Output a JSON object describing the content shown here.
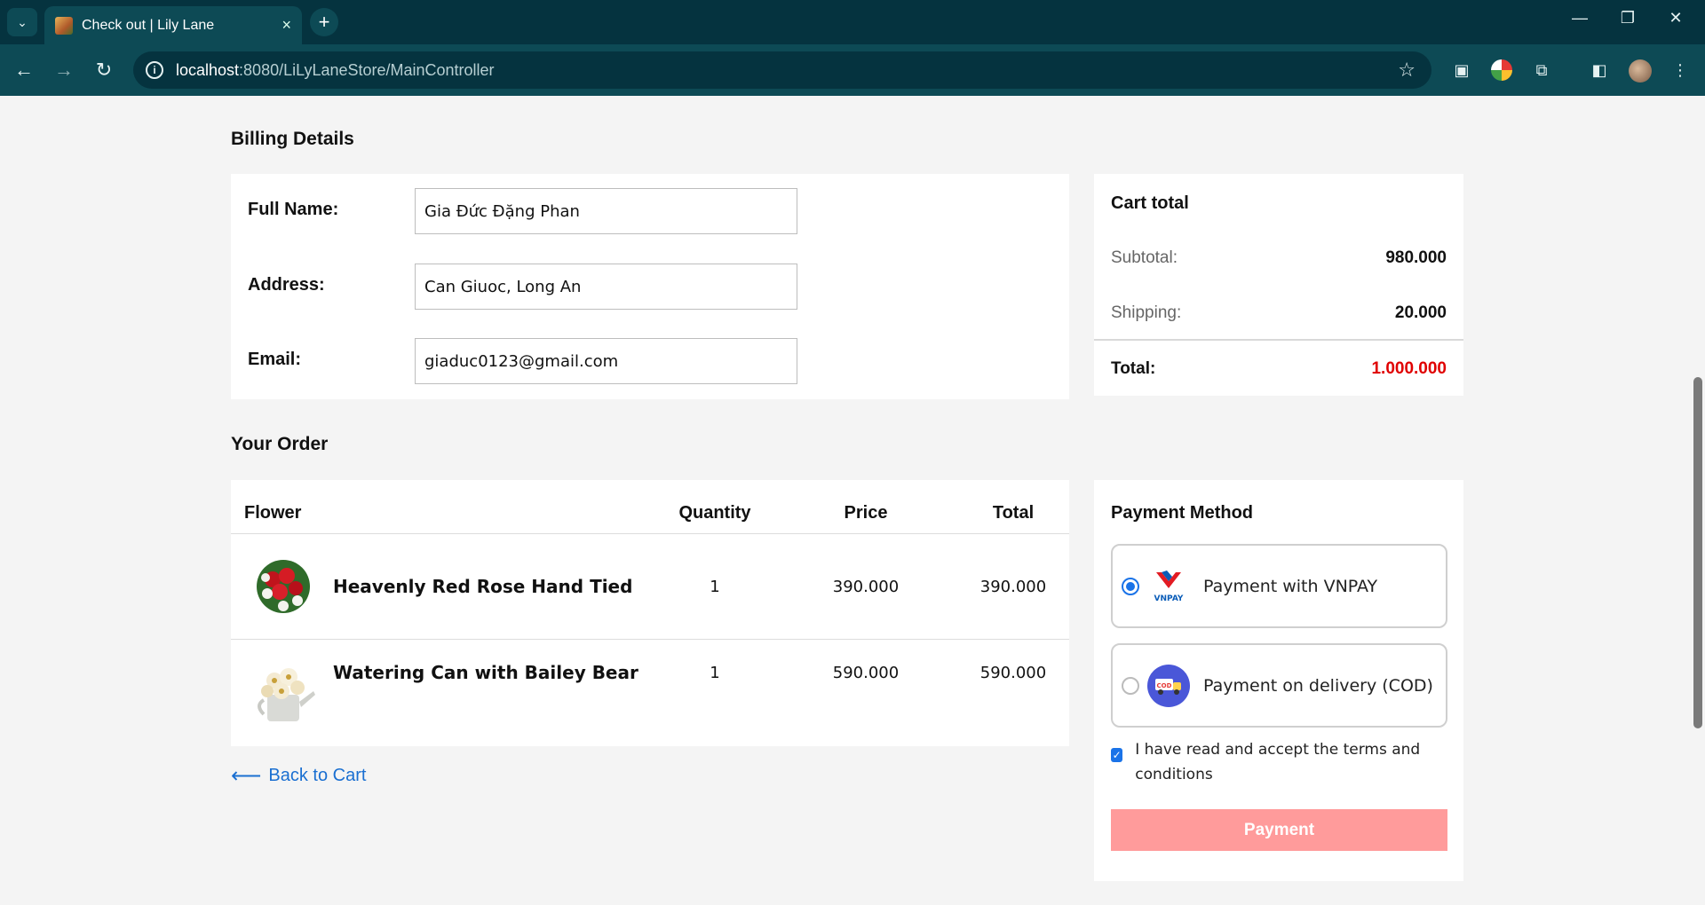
{
  "browser": {
    "tab_title": "Check out | Lily Lane",
    "url_host": "localhost",
    "url_path": ":8080/LiLyLaneStore/MainController"
  },
  "billing": {
    "section_title": "Billing Details",
    "full_name_label": "Full Name:",
    "full_name_value": "Gia Đức Đặng Phan",
    "address_label": "Address:",
    "address_value": "Can Giuoc, Long An",
    "email_label": "Email:",
    "email_value": "giaduc0123@gmail.com"
  },
  "cart_total": {
    "title": "Cart total",
    "subtotal_label": "Subtotal:",
    "subtotal_value": "980.000",
    "shipping_label": "Shipping:",
    "shipping_value": "20.000",
    "total_label": "Total:",
    "total_value": "1.000.000",
    "total_color": "#e00000"
  },
  "order": {
    "section_title": "Your Order",
    "headers": {
      "flower": "Flower",
      "quantity": "Quantity",
      "price": "Price",
      "total": "Total"
    },
    "items": [
      {
        "name": "Heavenly Red Rose Hand Tied",
        "quantity": "1",
        "price": "390.000",
        "total": "390.000"
      },
      {
        "name": "Watering Can with Bailey Bear",
        "quantity": "1",
        "price": "590.000",
        "total": "590.000"
      }
    ],
    "back_label": "Back to Cart"
  },
  "payment": {
    "title": "Payment Method",
    "options": [
      {
        "label": "Payment with VNPAY",
        "selected": true,
        "icon": "vnpay-logo"
      },
      {
        "label": "Payment on delivery (COD)",
        "selected": false,
        "icon": "cod-truck-icon"
      }
    ],
    "terms_text": "I have read and accept the terms and conditions",
    "terms_checked": true,
    "button_label": "Payment",
    "button_color": "#ff9b9b"
  }
}
